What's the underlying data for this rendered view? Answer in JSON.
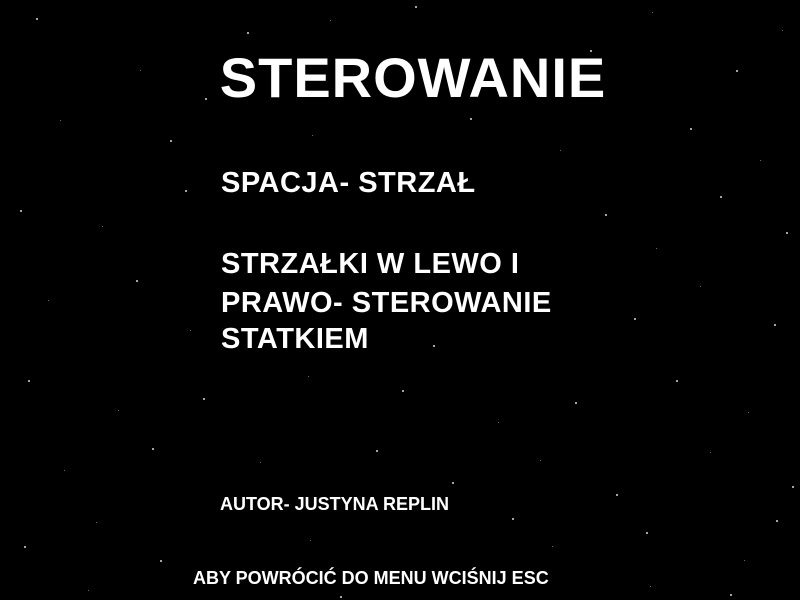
{
  "screen": {
    "title": "STEROWANIE",
    "controls": {
      "shoot": "SPACJA- STRZAŁ",
      "steer_lines": [
        "STRZAŁKI W LEWO I",
        "PRAWO- STEROWANIE",
        "STATKIEM"
      ]
    },
    "author": "AUTOR- JUSTYNA REPLIN",
    "back_hint": "ABY POWRÓCIĆ DO MENU WCIŚNIJ ESC"
  },
  "colors": {
    "background": "#000000",
    "text": "#ffffff",
    "stars": "#d8d8d8"
  }
}
